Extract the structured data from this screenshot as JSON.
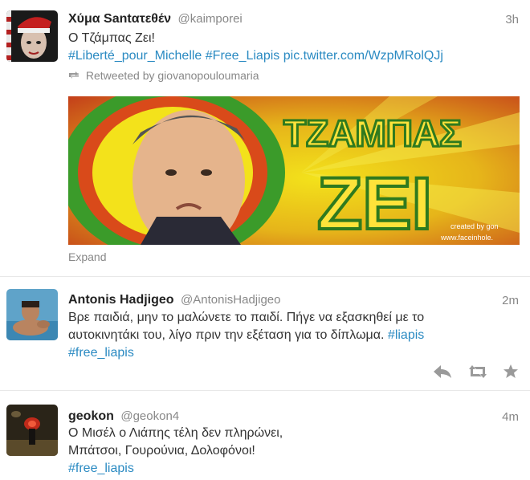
{
  "tweets": [
    {
      "fullname": "Χύμα Santατεθέν",
      "username": "@kaimporei",
      "time": "3h",
      "line1": "Ο Τζάμπας Ζει!",
      "tag1": "#Liberté_pour_Michelle",
      "tag2": "#Free_Liapis",
      "pic": "pic.twitter.com/WzpMRolQJj",
      "retweeted_by": "Retweeted by giovanopouloumaria",
      "media": {
        "word1": "ΤΖΑΜΠΑΣ",
        "word2": "ΖΕΙ",
        "credit1": "created by gon",
        "credit2": "www.faceinhole."
      },
      "expand": "Expand",
      "avatar_icon": "santa-hat-woman-avatar"
    },
    {
      "fullname": "Antonis Hadjigeo",
      "username": "@AntonisHadjigeo",
      "time": "2m",
      "line1": "Βρε παιδιά, μην το μαλώνετε το παιδί. Πήγε να εξασκηθεί με το",
      "line2": "αυτοκινητάκι του, λίγο πριν την εξέταση για το δίπλωμα.",
      "tag1": "#liapis",
      "tag2": "#free_liapis",
      "actions": [
        "reply-icon",
        "retweet-icon",
        "favorite-icon"
      ],
      "avatar_icon": "man-in-water-avatar"
    },
    {
      "fullname": "geokon",
      "username": "@geokon4",
      "time": "4m",
      "line1": "Ο Μισέλ ο Λιάπης τέλη δεν πληρώνει,",
      "line2": "Μπάτσοι, Γουρούνια, Δολοφόνοι!",
      "tag1": "#free_liapis",
      "avatar_icon": "dark-photo-avatar"
    }
  ],
  "colors": {
    "link": "#2a8ac2",
    "muted": "#888888",
    "name": "#222222",
    "media_yellow": "#f3e21b",
    "media_green": "#3b9b2a",
    "media_red": "#d94a1a"
  }
}
